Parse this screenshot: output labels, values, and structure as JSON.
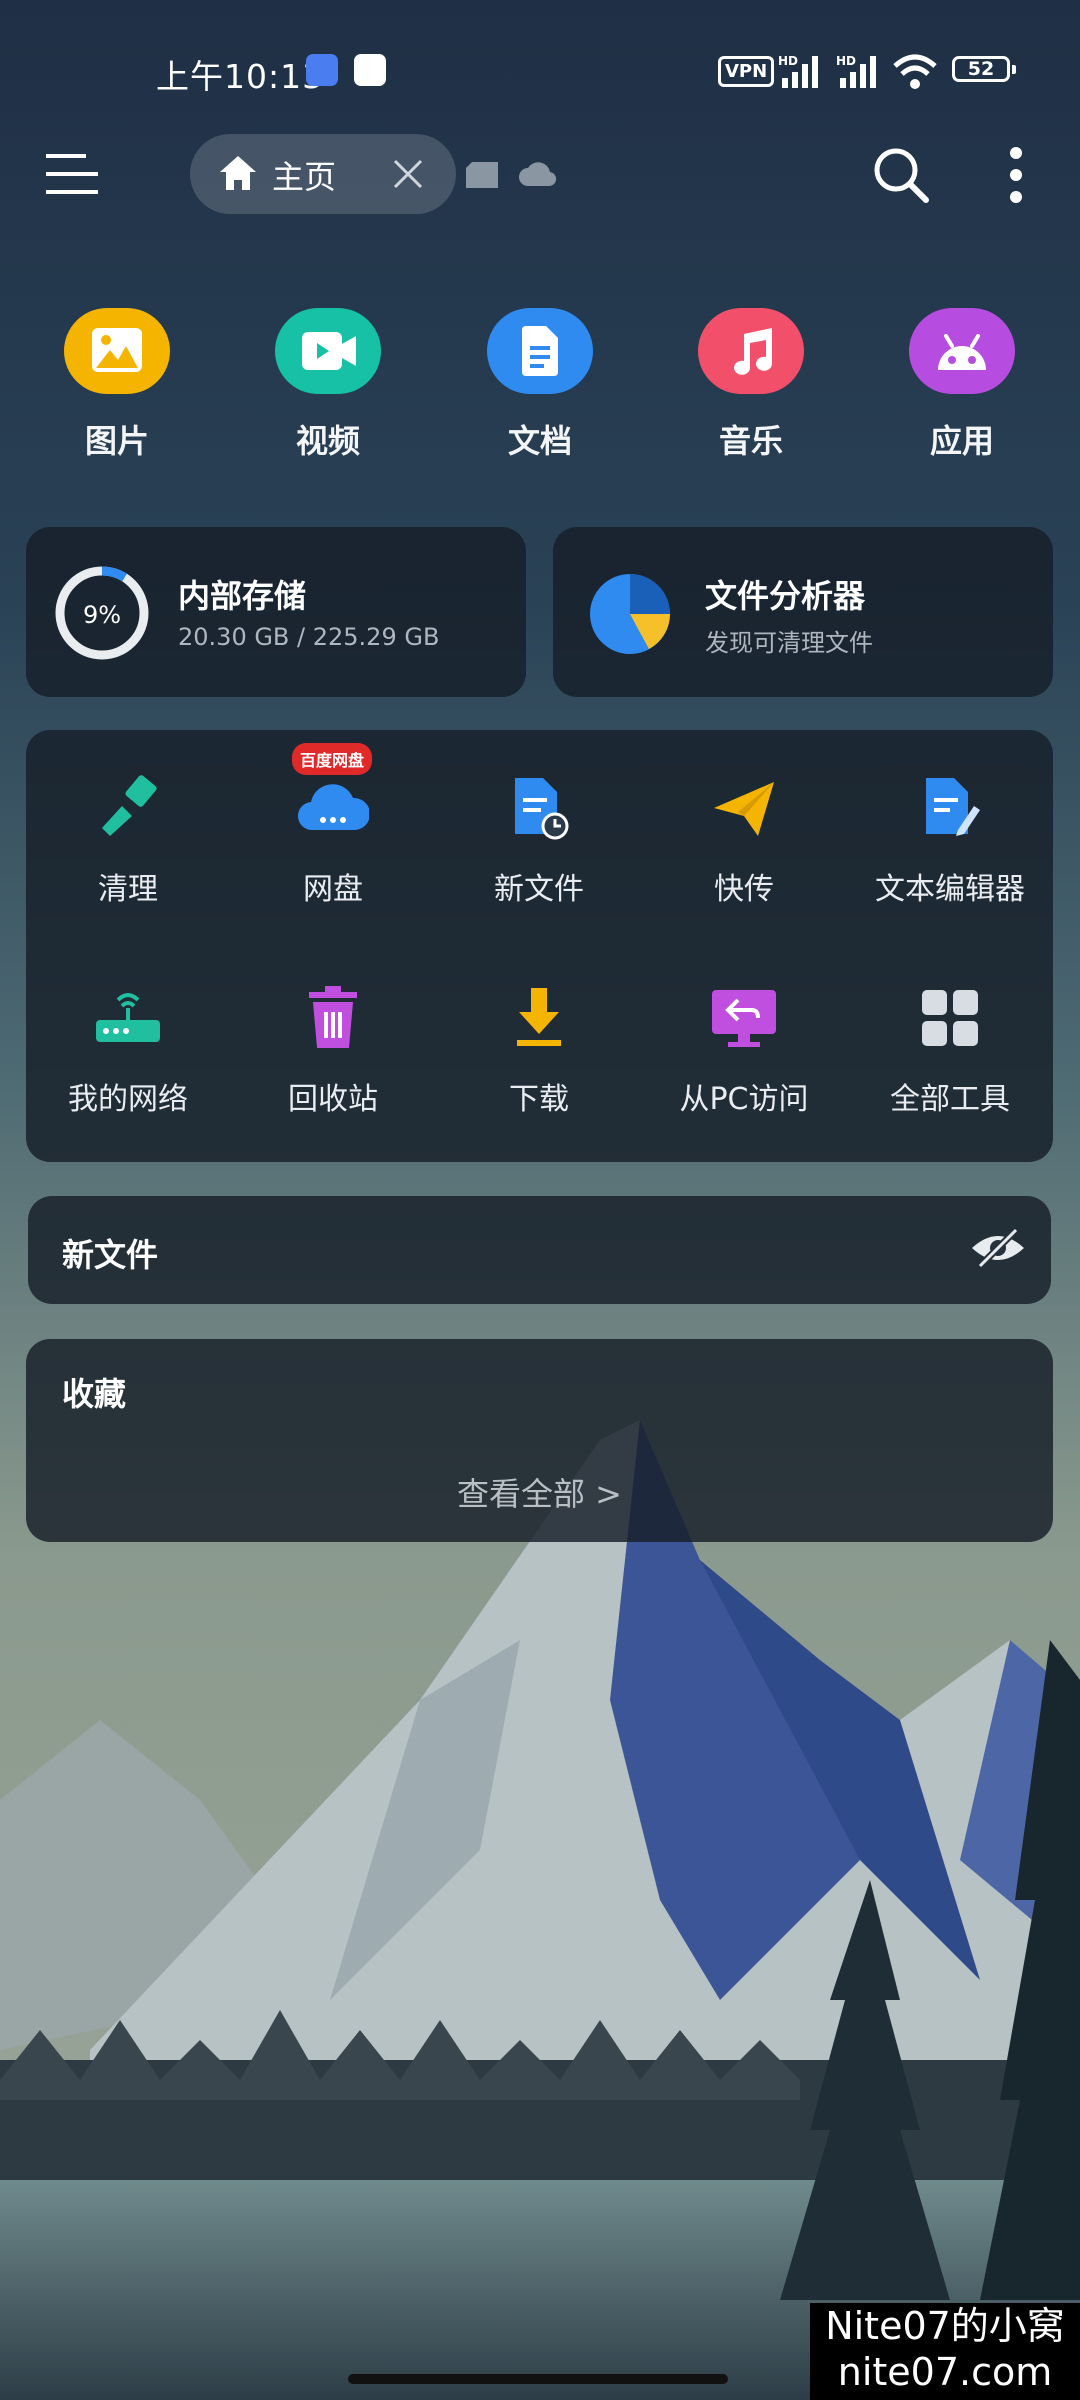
{
  "status_bar": {
    "time": "上午10:13",
    "vpn": "VPN",
    "hd_1": "HD",
    "hd_2": "HD",
    "battery": "52"
  },
  "header": {
    "tab_label": "主页"
  },
  "categories": [
    {
      "label": "图片",
      "color": "#f5b400"
    },
    {
      "label": "视频",
      "color": "#17c1a5"
    },
    {
      "label": "文档",
      "color": "#2f8bf0"
    },
    {
      "label": "音乐",
      "color": "#f2506a"
    },
    {
      "label": "应用",
      "color": "#b64ce0"
    }
  ],
  "storage": {
    "title": "内部存储",
    "usage": "20.30 GB / 225.29 GB",
    "percent_label": "9%",
    "used_fraction": 0.09
  },
  "analyzer": {
    "title": "文件分析器",
    "subtitle": "发现可清理文件"
  },
  "tools": [
    {
      "label": "清理",
      "icon": "broom-icon"
    },
    {
      "label": "网盘",
      "icon": "cloud-drive-icon",
      "badge": "百度网盘"
    },
    {
      "label": "新文件",
      "icon": "new-file-icon"
    },
    {
      "label": "快传",
      "icon": "paper-plane-icon"
    },
    {
      "label": "文本编辑器",
      "icon": "text-editor-icon"
    },
    {
      "label": "我的网络",
      "icon": "router-icon"
    },
    {
      "label": "回收站",
      "icon": "trash-icon"
    },
    {
      "label": "下载",
      "icon": "download-icon"
    },
    {
      "label": "从PC访问",
      "icon": "pc-access-icon"
    },
    {
      "label": "全部工具",
      "icon": "grid-icon"
    }
  ],
  "new_files": {
    "title": "新文件"
  },
  "favorites": {
    "title": "收藏",
    "view_all": "查看全部 >"
  },
  "watermark": {
    "line1": "Nite07的小窝",
    "line2": "nite07.com"
  }
}
